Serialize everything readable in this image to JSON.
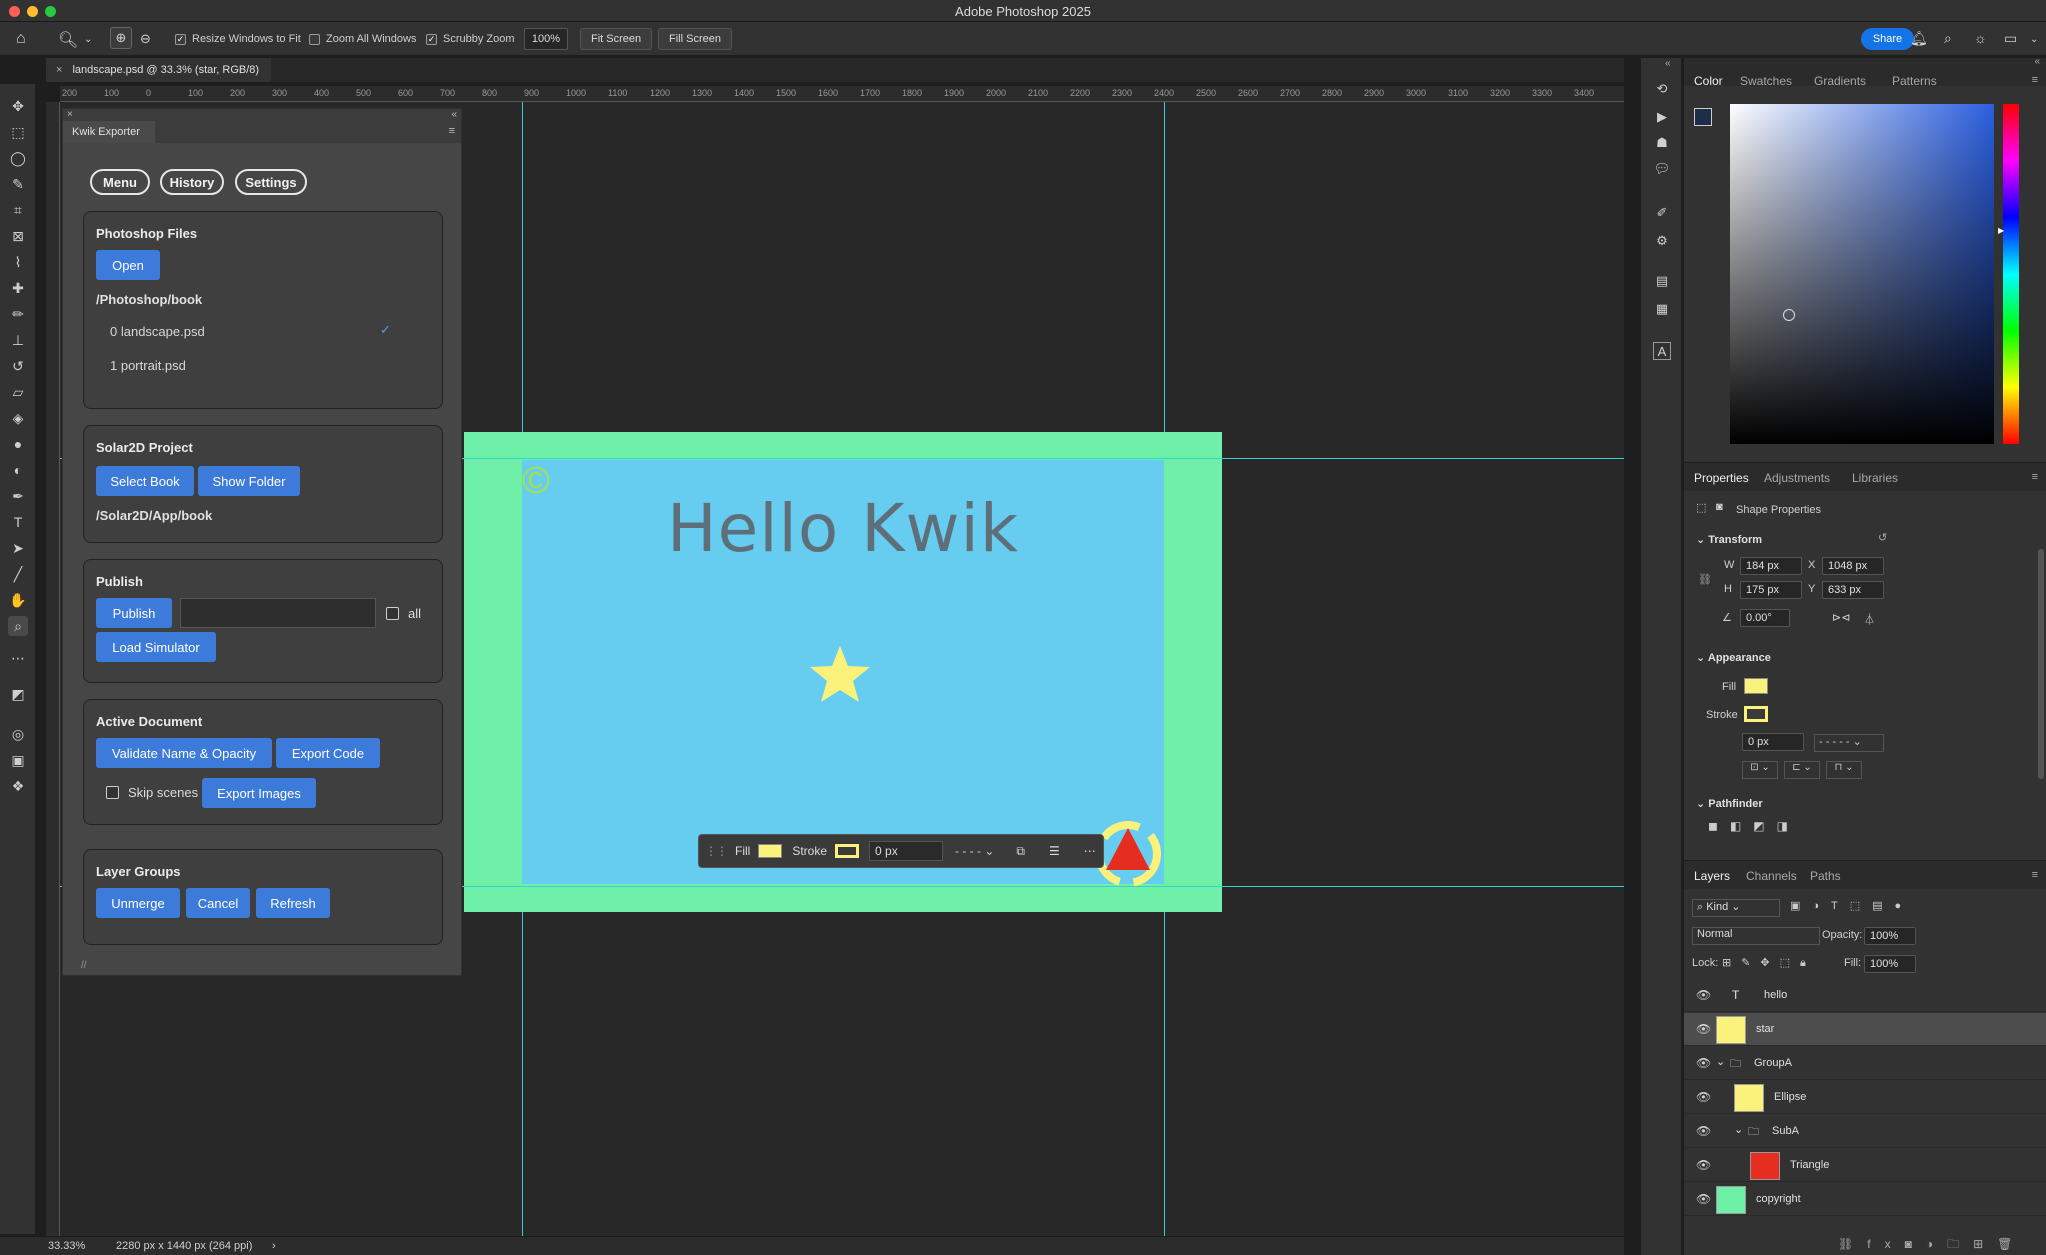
{
  "app": {
    "title": "Adobe Photoshop 2025"
  },
  "options": {
    "resize_windows": "Resize Windows to Fit",
    "zoom_all": "Zoom All Windows",
    "scrubby_zoom": "Scrubby Zoom",
    "zoom_value": "100%",
    "fit_screen": "Fit Screen",
    "fill_screen": "Fill Screen",
    "share": "Share"
  },
  "doc_tab": {
    "title": "landscape.psd @ 33.3% (star, RGB/8)"
  },
  "ruler": {
    "ticks": [
      "200",
      "100",
      "0",
      "100",
      "200",
      "300",
      "400",
      "500",
      "600",
      "700",
      "800",
      "900",
      "1000",
      "1100",
      "1200",
      "1300",
      "1400",
      "1500",
      "1600",
      "1700",
      "1800",
      "1900",
      "2000",
      "2100",
      "2200",
      "2300",
      "2400",
      "2500",
      "2600",
      "2700",
      "2800",
      "2900",
      "3000",
      "3100",
      "3200",
      "3300",
      "3400"
    ]
  },
  "canvas": {
    "hello_text": "Hello Kwik",
    "copyright": "©"
  },
  "ctx_bar": {
    "fill": "Fill",
    "stroke": "Stroke",
    "stroke_width": "0 px"
  },
  "status": {
    "zoom": "33.33%",
    "doc_size": "2280 px x 1440 px (264 ppi)"
  },
  "kwik": {
    "tab": "Kwik Exporter",
    "pills": {
      "menu": "Menu",
      "history": "History",
      "settings": "Settings"
    },
    "photoshop_files": {
      "title": "Photoshop Files",
      "open": "Open",
      "path": "/Photoshop/book",
      "files": [
        "0 landscape.psd",
        "1 portrait.psd"
      ],
      "check": "✓"
    },
    "solar2d": {
      "title": "Solar2D Project",
      "select_book": "Select Book",
      "show_folder": "Show Folder",
      "path": "/Solar2D/App/book"
    },
    "publish": {
      "title": "Publish",
      "publish": "Publish",
      "all": "all",
      "load_simulator": "Load Simulator"
    },
    "active_doc": {
      "title": "Active Document",
      "validate": "Validate Name & Opacity",
      "export_code": "Export Code",
      "skip_scenes": "Skip scenes",
      "export_images": "Export Images"
    },
    "layer_groups": {
      "title": "Layer Groups",
      "unmerge": "Unmerge",
      "cancel": "Cancel",
      "refresh": "Refresh"
    }
  },
  "color_panel": {
    "tabs": [
      "Color",
      "Swatches",
      "Gradients",
      "Patterns"
    ]
  },
  "properties_panel": {
    "tabs": [
      "Properties",
      "Adjustments",
      "Libraries"
    ],
    "subtitle": "Shape Properties",
    "transform": {
      "title": "Transform",
      "w_label": "W",
      "w": "184 px",
      "x_label": "X",
      "x": "1048 px",
      "h_label": "H",
      "h": "175 px",
      "y_label": "Y",
      "y": "633 px",
      "angle": "0.00°"
    },
    "appearance": {
      "title": "Appearance",
      "fill_label": "Fill",
      "stroke_label": "Stroke",
      "stroke_width": "0 px"
    },
    "pathfinder": {
      "title": "Pathfinder"
    }
  },
  "layers_panel": {
    "tabs": [
      "Layers",
      "Channels",
      "Paths"
    ],
    "kind": "Kind",
    "blend": "Normal",
    "opacity_label": "Opacity:",
    "opacity": "100%",
    "lock_label": "Lock:",
    "fill_label": "Fill:",
    "fill": "100%",
    "layers": [
      "hello",
      "star",
      "GroupA",
      "Ellipse",
      "SubA",
      "Triangle",
      "copyright"
    ]
  }
}
